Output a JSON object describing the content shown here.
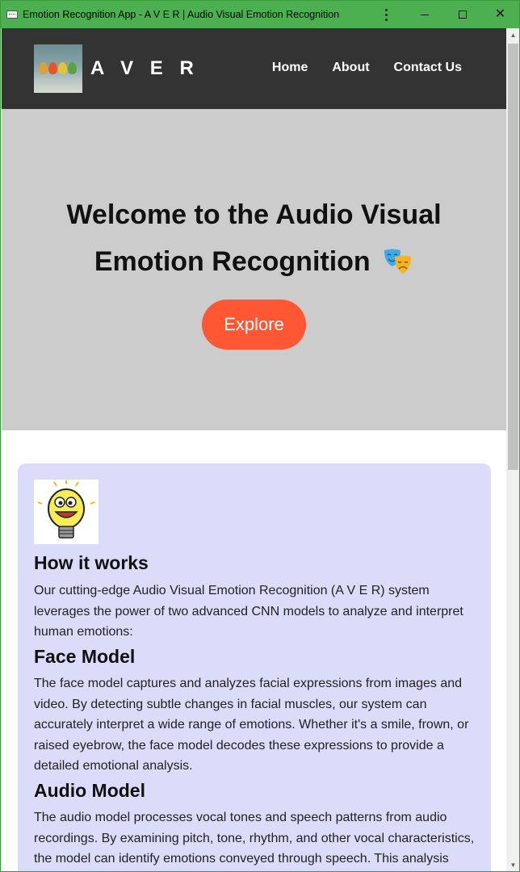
{
  "window": {
    "title": "Emotion Recognition App - A V E R | Audio Visual Emotion Recognition"
  },
  "nav": {
    "brand": "A V E R",
    "links": [
      "Home",
      "About",
      "Contact Us"
    ]
  },
  "hero": {
    "title_line1": "Welcome to the Audio Visual",
    "title_line2": "Emotion Recognition",
    "button": "Explore"
  },
  "how": {
    "heading": "How it works",
    "intro": "Our cutting-edge Audio Visual Emotion Recognition (A V E R) system leverages the power of two advanced CNN models to analyze and interpret human emotions:",
    "face_heading": "Face Model",
    "face_text": "The face model captures and analyzes facial expressions from images and video. By detecting subtle changes in facial muscles, our system can accurately interpret a wide range of emotions. Whether it's a smile, frown, or raised eyebrow, the face model decodes these expressions to provide a detailed emotional analysis.",
    "audio_heading": "Audio Model",
    "audio_text": "The audio model processes vocal tones and speech patterns from audio recordings. By examining pitch, tone, rhythm, and other vocal characteristics, the model can identify emotions conveyed through speech. This analysis"
  },
  "colors": {
    "titlebar": "#4caf50",
    "navbar": "#333333",
    "hero_bg": "#cccccc",
    "accent_button": "#ff5733",
    "card_bg": "#dadcf9"
  }
}
